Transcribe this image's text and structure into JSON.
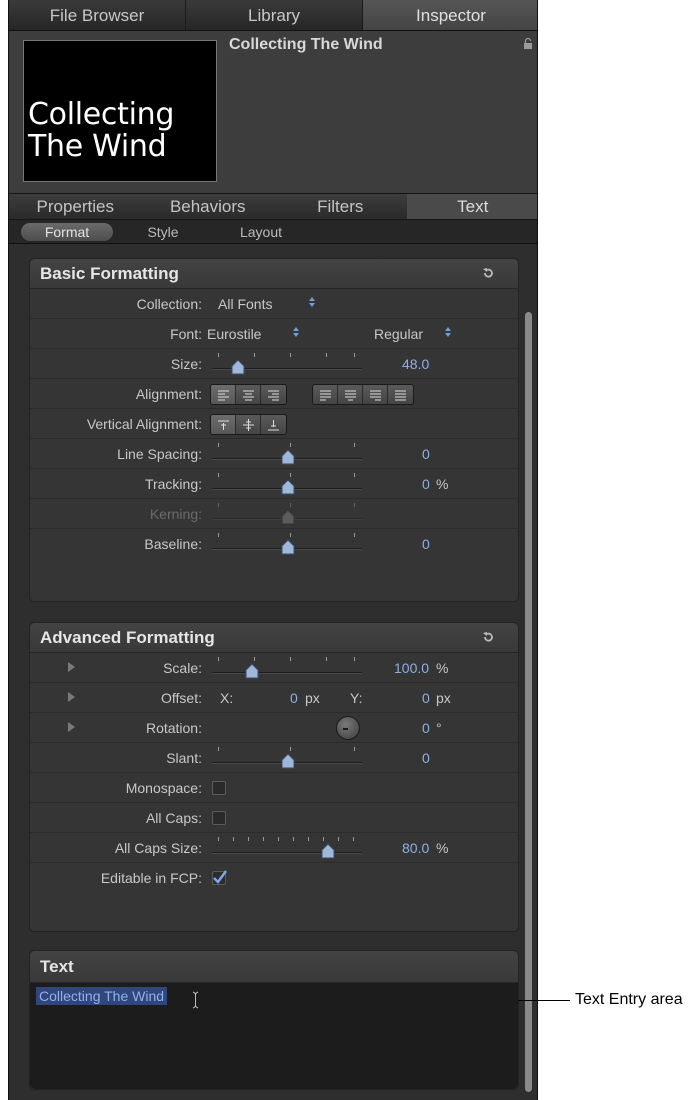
{
  "top_tabs": [
    "File Browser",
    "Library",
    "Inspector"
  ],
  "preview": {
    "title": "Collecting The Wind",
    "thumb_line1": "Collecting",
    "thumb_line2": "The Wind"
  },
  "sub_tabs": [
    "Properties",
    "Behaviors",
    "Filters",
    "Text"
  ],
  "segments": [
    "Format",
    "Style",
    "Layout"
  ],
  "basic": {
    "title": "Basic Formatting",
    "collection_label": "Collection:",
    "collection_value": "All Fonts",
    "font_label": "Font:",
    "font_value": "Eurostile",
    "font_style": "Regular",
    "size_label": "Size:",
    "size_value": "48.0",
    "alignment_label": "Alignment:",
    "valign_label": "Vertical Alignment:",
    "line_spacing_label": "Line Spacing:",
    "line_spacing_value": "0",
    "tracking_label": "Tracking:",
    "tracking_value": "0",
    "tracking_unit": "%",
    "kerning_label": "Kerning:",
    "baseline_label": "Baseline:",
    "baseline_value": "0"
  },
  "advanced": {
    "title": "Advanced Formatting",
    "scale_label": "Scale:",
    "scale_value": "100.0",
    "scale_unit": "%",
    "offset_label": "Offset:",
    "offset_x_label": "X:",
    "offset_x_value": "0",
    "offset_x_unit": "px",
    "offset_y_label": "Y:",
    "offset_y_value": "0",
    "offset_y_unit": "px",
    "rotation_label": "Rotation:",
    "rotation_value": "0",
    "rotation_unit": "°",
    "slant_label": "Slant:",
    "slant_value": "0",
    "monospace_label": "Monospace:",
    "allcaps_label": "All Caps:",
    "allcaps_size_label": "All Caps Size:",
    "allcaps_size_value": "80.0",
    "allcaps_size_unit": "%",
    "editable_label": "Editable in FCP:",
    "editable_checked": true
  },
  "text_group": {
    "title": "Text",
    "content": "Collecting The Wind"
  },
  "callout": "Text Entry area",
  "colors": {
    "accent_value": "#8cb0e4",
    "selection": "#31467a",
    "checkmark": "#7fa8ec"
  }
}
